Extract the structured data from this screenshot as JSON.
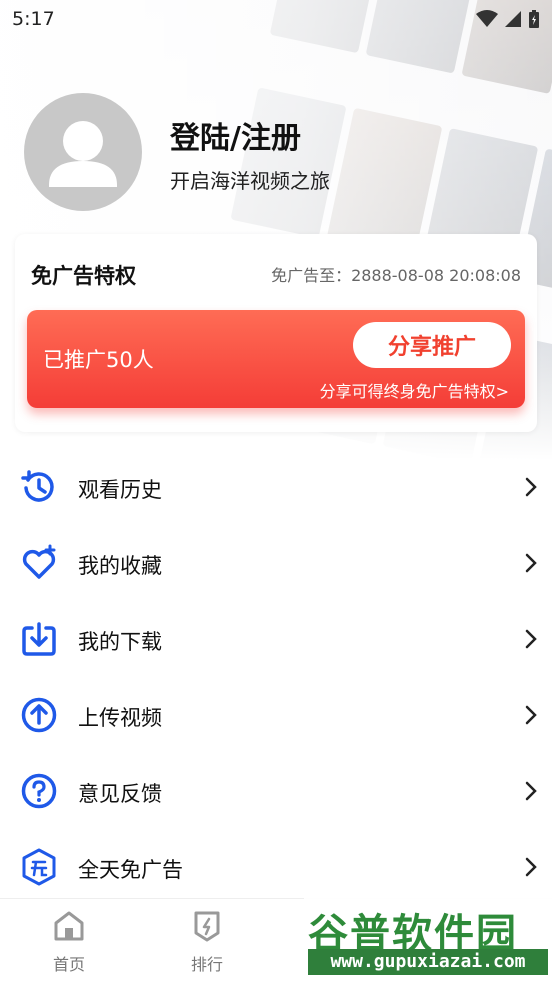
{
  "status_bar": {
    "time": "5:17"
  },
  "profile": {
    "title": "登陆/注册",
    "subtitle": "开启海洋视频之旅"
  },
  "ad_card": {
    "title": "免广告特权",
    "expire": "免广告至：2888-08-08 20:08:08",
    "promoted": "已推广50人",
    "share_button": "分享推广",
    "share_link": "分享可得终身免广告特权>"
  },
  "menu": [
    {
      "label": "观看历史",
      "icon": "history-icon"
    },
    {
      "label": "我的收藏",
      "icon": "heart-plus-icon"
    },
    {
      "label": "我的下载",
      "icon": "download-icon"
    },
    {
      "label": "上传视频",
      "icon": "upload-icon"
    },
    {
      "label": "意见反馈",
      "icon": "question-icon"
    },
    {
      "label": "全天免广告",
      "icon": "ad-free-icon"
    }
  ],
  "tabbar": [
    {
      "label": "首页",
      "icon": "home-icon"
    },
    {
      "label": "排行",
      "icon": "ranking-icon"
    }
  ],
  "watermark": {
    "top": "谷普软件园",
    "bottom": "www.gupuxiazai.com"
  },
  "colors": {
    "accent_blue": "#1f59e8",
    "promo_red": "#f43d37"
  }
}
